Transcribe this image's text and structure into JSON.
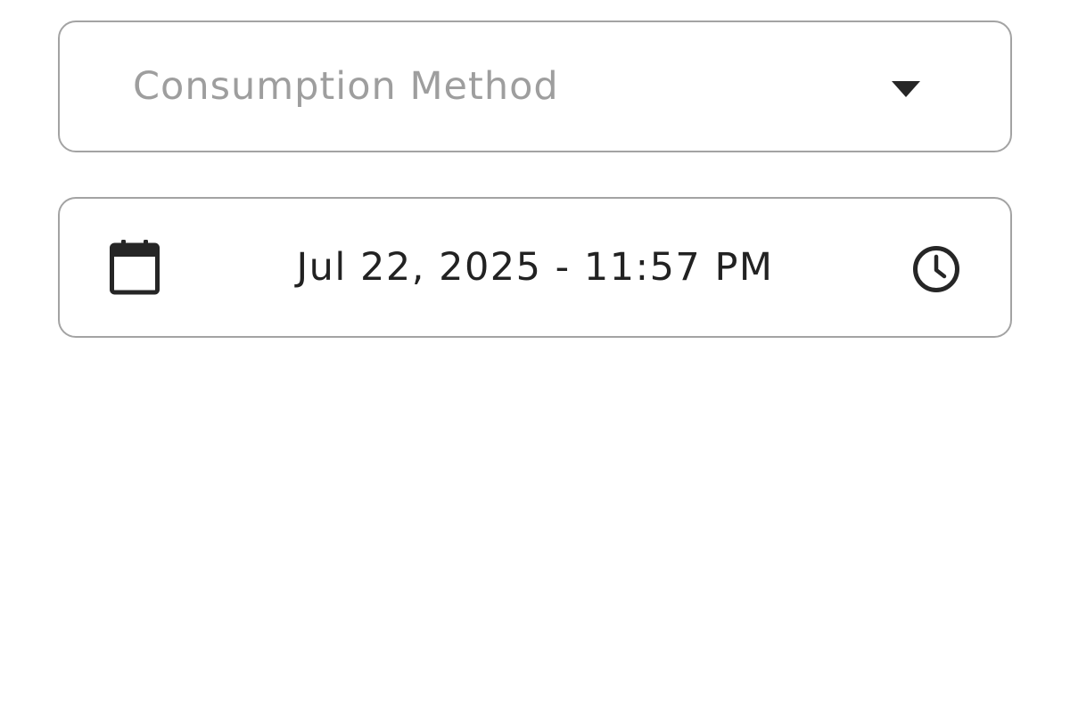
{
  "consumption_method": {
    "placeholder": "Consumption Method",
    "arrow_icon": "dropdown-arrow-icon"
  },
  "datetime": {
    "value": "Jul 22, 2025 - 11:57 PM",
    "left_icon": "calendar-icon",
    "right_icon": "clock-icon"
  },
  "colors": {
    "border": "#a3a3a3",
    "placeholder": "#9e9e9e",
    "text": "#222222",
    "icon": "#262626"
  }
}
